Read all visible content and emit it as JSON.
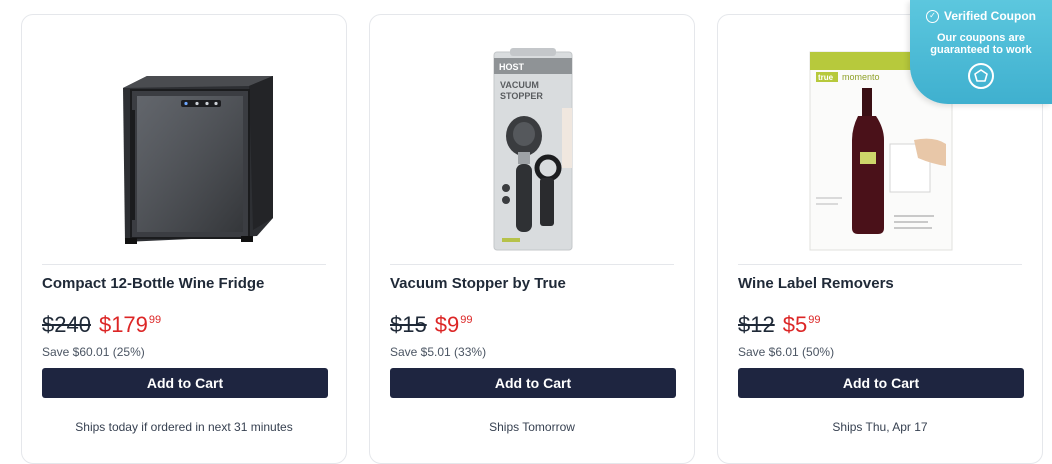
{
  "products": [
    {
      "title": "Compact 12-Bottle Wine Fridge",
      "old_price": "$240",
      "price_dollars": "$179",
      "price_cents": "99",
      "save": "Save $60.01 (25%)",
      "cart_label": "Add to Cart",
      "shipping": "Ships today if ordered in next 31 minutes",
      "image_icon": "wine-fridge-image"
    },
    {
      "title": "Vacuum Stopper by True",
      "old_price": "$15",
      "price_dollars": "$9",
      "price_cents": "99",
      "save": "Save $5.01 (33%)",
      "cart_label": "Add to Cart",
      "shipping": "Ships Tomorrow",
      "image_icon": "vacuum-stopper-image",
      "package_brand": "HOST",
      "package_line1": "VACUUM",
      "package_line2": "STOPPER"
    },
    {
      "title": "Wine Label Removers",
      "old_price": "$12",
      "price_dollars": "$5",
      "price_cents": "99",
      "save": "Save $6.01 (50%)",
      "cart_label": "Add to Cart",
      "shipping": "Ships Thu, Apr 17",
      "image_icon": "wine-label-remover-image",
      "package_brand": "true",
      "package_name": "momento"
    }
  ],
  "badge": {
    "title": "Verified Coupon",
    "line1": "Our coupons are",
    "line2": "guaranteed to work",
    "icon": "shield-badge-icon",
    "color": "#4dbdd8"
  },
  "colors": {
    "cart_button": "#1e2540",
    "sale_price": "#dc2626"
  }
}
